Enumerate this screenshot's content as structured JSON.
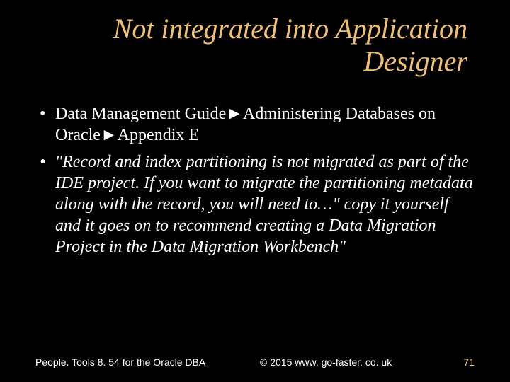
{
  "title": "Not integrated into Application Designer",
  "bullets": [
    {
      "text": "Data Management Guide►Administering Databases on Oracle►Appendix E",
      "italic": false
    },
    {
      "text": "\"Record and index partitioning is not migrated as part of the IDE project. If you want to migrate the partitioning metadata along with the record, you will need to…\" copy it yourself and it goes on to recommend creating a Data Migration Project in the Data Migration Workbench\"",
      "italic": true
    }
  ],
  "footer": {
    "left": "People. Tools 8. 54 for the Oracle DBA",
    "center": "© 2015 www. go-faster. co. uk",
    "right": "71"
  }
}
